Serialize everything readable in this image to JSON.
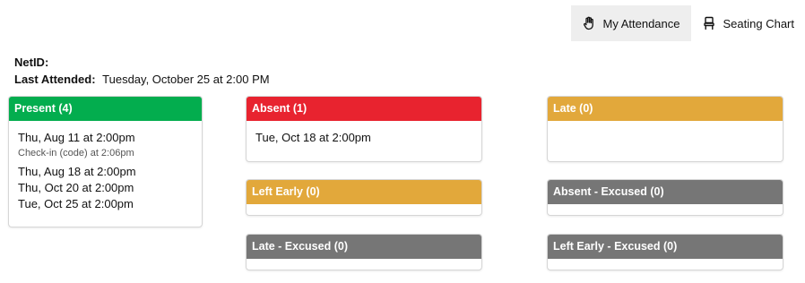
{
  "nav": {
    "attendance_label": "My Attendance",
    "seating_label": "Seating Chart"
  },
  "info": {
    "netid_label": "NetID:",
    "netid_value": "",
    "last_label": "Last Attended:",
    "last_value": "Tuesday, October 25 at 2:00 PM"
  },
  "colors": {
    "present": "#03ad4e",
    "absent": "#e8232f",
    "late": "#e2a83b",
    "excused": "#767676"
  },
  "cards": {
    "present": {
      "title": "Present (4)",
      "entries": [
        {
          "date": "Thu, Aug 11 at 2:00pm",
          "note": "Check-in (code) at 2:06pm"
        },
        {
          "date": "Thu, Aug 18 at 2:00pm"
        },
        {
          "date": "Thu, Oct 20 at 2:00pm"
        },
        {
          "date": "Tue, Oct 25 at 2:00pm"
        }
      ]
    },
    "absent": {
      "title": "Absent (1)",
      "entries": [
        {
          "date": "Tue, Oct 18 at 2:00pm"
        }
      ]
    },
    "late": {
      "title": "Late (0)"
    },
    "left_early": {
      "title": "Left Early (0)"
    },
    "absent_excused": {
      "title": "Absent - Excused (0)"
    },
    "late_excused": {
      "title": "Late - Excused (0)"
    },
    "left_early_excused": {
      "title": "Left Early - Excused (0)"
    }
  }
}
